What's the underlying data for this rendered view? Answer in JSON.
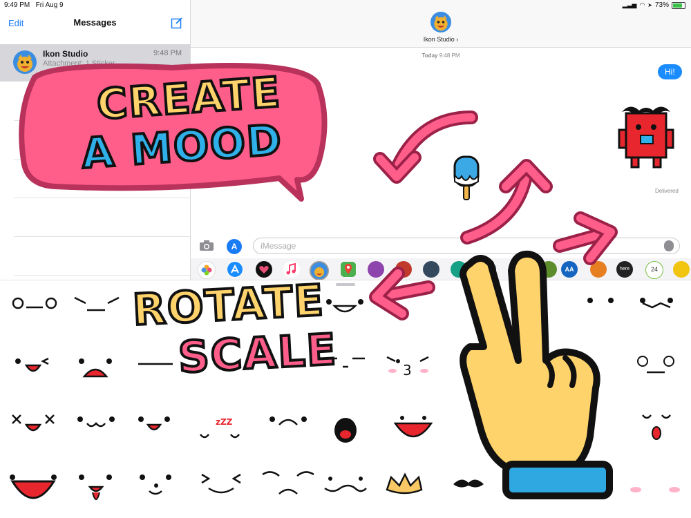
{
  "status": {
    "time": "9:49 PM",
    "date": "Fri Aug 9",
    "battery": "73%"
  },
  "sidebar": {
    "edit": "Edit",
    "title": "Messages",
    "conversation": {
      "name": "Ikon Studio",
      "time": "9:48 PM",
      "preview": "Attachment: 1 Sticker"
    }
  },
  "chat": {
    "contact": "Ikon Studio ›",
    "timestamp_day": "Today",
    "timestamp_time": "9:48 PM",
    "bubble": "Hi!",
    "delivered": "Delivered",
    "input_placeholder": "iMessage"
  },
  "tray": {
    "badge_24": "24",
    "aa": "AA",
    "here": "here"
  },
  "promo": {
    "line1": "CREATE",
    "line2": "A MOOD",
    "line3": "ROTATE",
    "line4": "SCALE"
  },
  "colors": {
    "pink": "#ff5e8a",
    "pink_border": "#c2335f",
    "yellow": "#ffd36b",
    "blue": "#2fb0e8",
    "imessage_blue": "#1a8cff"
  },
  "icons": [
    "camera-icon",
    "app-store-icon",
    "mic-icon",
    "compose-icon",
    "wifi-icon",
    "battery-icon",
    "photos-icon",
    "music-icon",
    "maps-icon"
  ]
}
